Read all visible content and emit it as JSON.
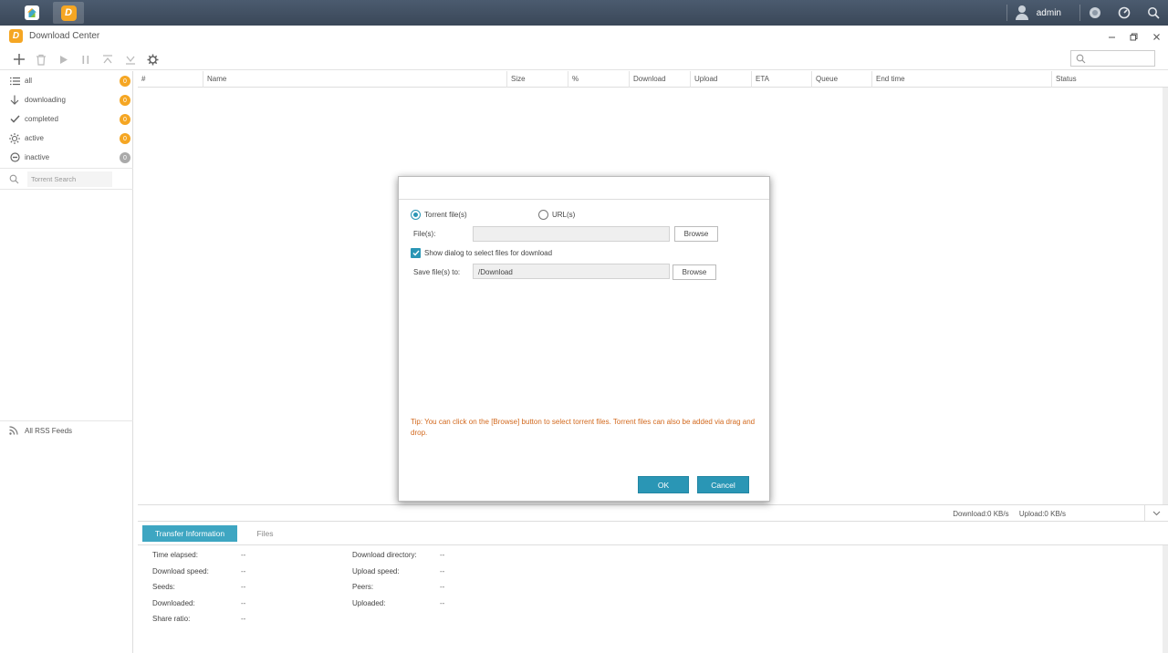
{
  "taskbar": {
    "user": "admin"
  },
  "window": {
    "title": "Download Center"
  },
  "sidebar": {
    "items": [
      {
        "label": "all",
        "count": "0"
      },
      {
        "label": "downloading",
        "count": "0"
      },
      {
        "label": "completed",
        "count": "0"
      },
      {
        "label": "active",
        "count": "0"
      },
      {
        "label": "inactive",
        "count": "0"
      }
    ],
    "search_placeholder": "Torrent Search",
    "rss_label": "All RSS Feeds"
  },
  "table": {
    "columns": [
      "#",
      "Name",
      "Size",
      "%",
      "Download",
      "Upload",
      "ETA",
      "Queue",
      "End time",
      "Status"
    ]
  },
  "status": {
    "download": "Download:0 KB/s",
    "upload": "Upload:0 KB/s"
  },
  "bottom": {
    "tabs": [
      "Transfer Information",
      "Files"
    ],
    "left": [
      {
        "label": "Time elapsed:",
        "value": "--"
      },
      {
        "label": "Download speed:",
        "value": "--"
      },
      {
        "label": "Seeds:",
        "value": "--"
      },
      {
        "label": "Downloaded:",
        "value": "--"
      },
      {
        "label": "Share ratio:",
        "value": "--"
      }
    ],
    "right": [
      {
        "label": "Download directory:",
        "value": "--"
      },
      {
        "label": "Upload speed:",
        "value": "--"
      },
      {
        "label": "Peers:",
        "value": "--"
      },
      {
        "label": "Uploaded:",
        "value": "--"
      }
    ]
  },
  "dialog": {
    "radio_torrent": "Torrent file(s)",
    "radio_url": "URL(s)",
    "files_label": "File(s):",
    "files_value": "",
    "browse1": "Browse",
    "checkbox_label": "Show dialog to select files for download",
    "save_label": "Save file(s) to:",
    "save_value": "/Download",
    "browse2": "Browse",
    "tip": "Tip: You can click on the [Browse] button to select torrent files. Torrent files can also be added via drag and drop.",
    "ok": "OK",
    "cancel": "Cancel"
  },
  "colors": {
    "accent": "#2a96b5",
    "badge": "#f5a623",
    "tip": "#d2691e",
    "taskbar": "#3f4c5e"
  }
}
